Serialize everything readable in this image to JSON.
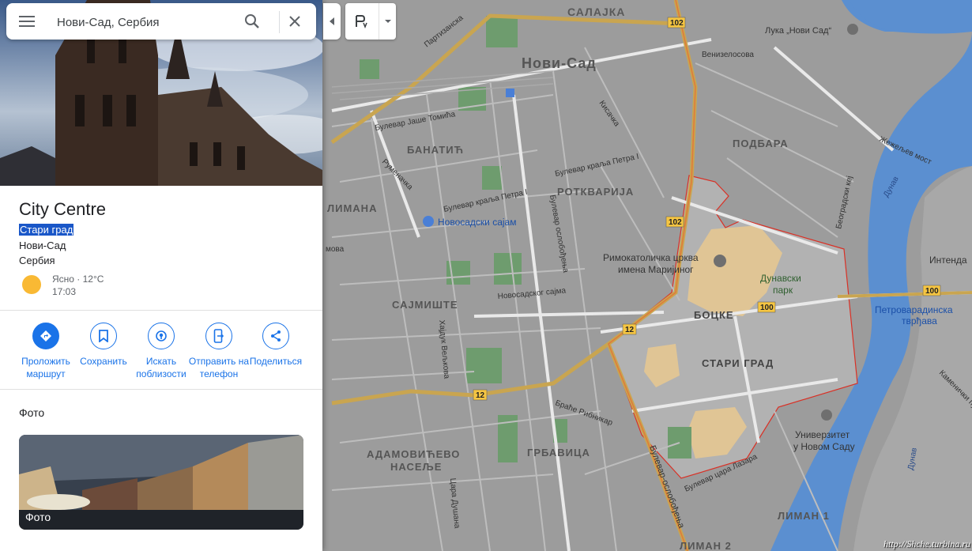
{
  "search": {
    "value": "Нови-Сад, Сербия"
  },
  "place": {
    "title": "City Centre",
    "subtitle": "Стари град",
    "city": "Нови-Сад",
    "country": "Сербия",
    "weather": "Ясно · 12°C",
    "time": "17:03"
  },
  "actions": [
    {
      "label": "Проложить маршрут",
      "icon": "directions-icon"
    },
    {
      "label": "Сохранить",
      "icon": "bookmark-icon"
    },
    {
      "label": "Искать поблизости",
      "icon": "nearby-icon"
    },
    {
      "label": "Отправить на телефон",
      "icon": "send-to-phone-icon"
    },
    {
      "label": "Поделиться",
      "icon": "share-icon"
    }
  ],
  "photos": {
    "heading": "Фото",
    "card_label": "Фото"
  },
  "map_labels": {
    "salajka": "САЛАЈКА",
    "novi_sad": "Нови-Сад",
    "partizanska": "Партизанска",
    "luka": "Лука „Нови Сад“",
    "venizelosova": "Венизелосова",
    "bul_jase": "Булевар Јаше Томића",
    "kisacka": "Кисачка",
    "banatic": "БАНАТИЋ",
    "podbara": "ПОДБАРА",
    "zezeljev": "Жежељев мост",
    "rumenacka": "Руменачка",
    "bul_petra_1": "Булевар краља Петра I",
    "bul_petra_2": "Булевар краља Петра I",
    "rotkvarija": "РОТКВАРИЈА",
    "beogradski": "Београдски кеј",
    "dunav": "Дунав",
    "dunav2": "Дунав",
    "liman_partial": "ЛИМАНА",
    "sajam": "Новосадски сајам",
    "bul_osl": "Булевар ослобођења",
    "rimokat": "Римокатоличка црква",
    "rimokat2": "имена Маријиног",
    "dunavski": "Дунавски",
    "park": "парк",
    "intend": "Интенда",
    "petrovaradin": "Петроварадинска",
    "tvrdjava": "тврђава",
    "sajmiste": "САЈМИШТЕ",
    "novosadskog": "Новосадског сајма",
    "bocke": "БОЦКЕ",
    "hajduk": "Хајдук Вељкова",
    "stari_grad": "СТАРИ ГРАД",
    "kamenicki": "Каменички пут",
    "braca": "Браће Рибникар",
    "univerzitet1": "Универзитет",
    "univerzitet2": "у Новом Саду",
    "adamovicevo": "АДАМОВИЋЕВО",
    "naselje": "НАСЕЉЕ",
    "grbavica": "ГРБАВИЦА",
    "bul_osl2": "Булевар-ослобођења",
    "bul_cara": "Булевар цара Лазара",
    "cara_dusana": "Цара Душана",
    "liman1": "ЛИМАН 1",
    "liman2": "ЛИМАН 2",
    "morova": "мова",
    "r102a": "102",
    "r102b": "102",
    "r100a": "100",
    "r100b": "100",
    "r12a": "12",
    "r12b": "12"
  },
  "watermark": "http://Shche.turbina.ru",
  "colors": {
    "map_bg": "#9e9e9e",
    "road_major": "#c9a550",
    "water": "#5b8fd0",
    "park": "#6aa16a",
    "accent": "#1a73e8",
    "boundary": "#d93025"
  }
}
